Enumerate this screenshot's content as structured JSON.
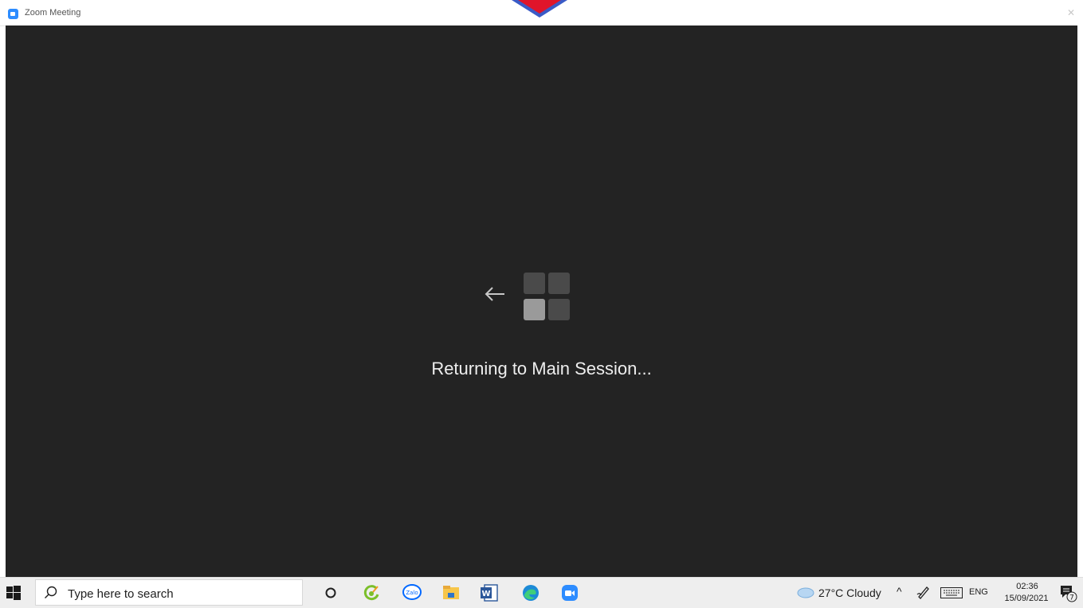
{
  "window": {
    "title": "Zoom Meeting",
    "close_glyph": "✕"
  },
  "meeting": {
    "status_text": "Returning to Main Session...",
    "background_color": "#232323"
  },
  "taskbar": {
    "search_placeholder": "Type here to search",
    "apps": [
      "cortana-icon",
      "greenshot-icon",
      "zalo-icon",
      "file-explorer-icon",
      "word-icon",
      "edge-icon",
      "zoom-icon"
    ],
    "weather": "27°C  Cloudy",
    "up_glyph": "^",
    "language": "ENG",
    "time": "02:36",
    "date": "15/09/2021",
    "notification_count": "7"
  },
  "colors": {
    "marker_red": "#e0152a",
    "marker_blue": "#3a5bc7",
    "zoom_blue": "#2d8cff"
  }
}
